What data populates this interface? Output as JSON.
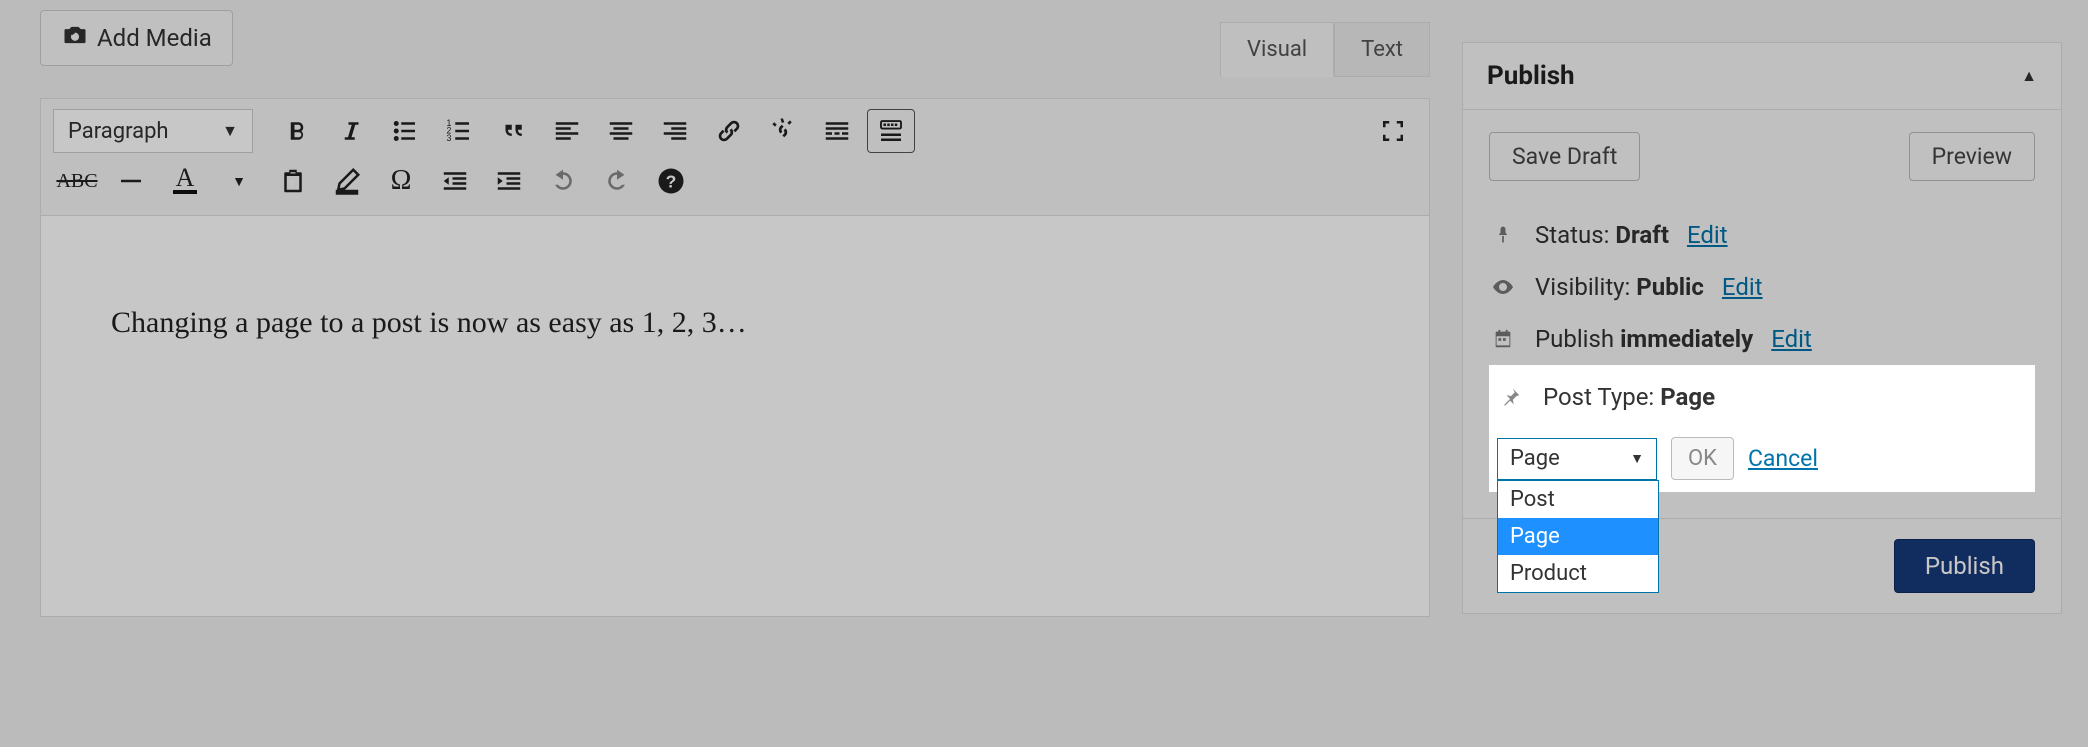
{
  "editor": {
    "add_media": "Add Media",
    "tabs": {
      "visual": "Visual",
      "text": "Text"
    },
    "format_label": "Paragraph",
    "content": "Changing a page to a post is now as easy as 1, 2, 3…"
  },
  "publish": {
    "title": "Publish",
    "save_draft": "Save Draft",
    "preview": "Preview",
    "status_label": "Status:",
    "status_value": "Draft",
    "visibility_label": "Visibility:",
    "visibility_value": "Public",
    "schedule_label": "Publish",
    "schedule_value": "immediately",
    "edit": "Edit",
    "posttype_label": "Post Type:",
    "posttype_value": "Page",
    "pt_selected": "Page",
    "pt_options": [
      "Post",
      "Page",
      "Product"
    ],
    "ok": "OK",
    "cancel": "Cancel",
    "publish_btn": "Publish"
  }
}
